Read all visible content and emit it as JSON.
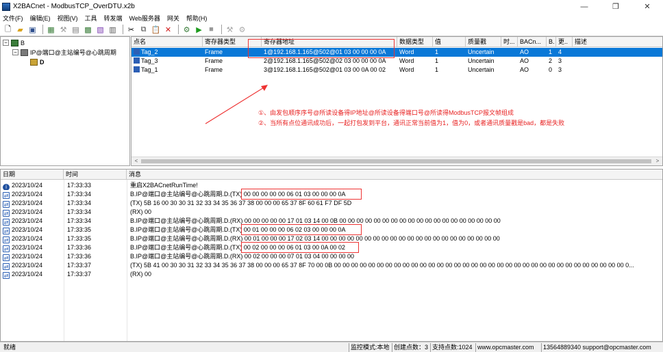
{
  "window": {
    "title": "X2BACnet - ModbusTCP_OverDTU.x2b",
    "controls": [
      "—",
      "❐",
      "✕"
    ]
  },
  "menu": [
    "文件(F)",
    "编辑(E)",
    "视图(V)",
    "工具",
    "转发端",
    "Web服务器",
    "网关",
    "帮助(H)"
  ],
  "toolbar_icons": [
    "new-file-icon",
    "open-folder-icon",
    "save-icon",
    "add-device-icon",
    "add-node-icon",
    "add-group-icon",
    "import-icon",
    "export-icon",
    "properties-icon",
    "cut-icon",
    "copy-icon",
    "paste-icon",
    "delete-icon",
    "monitor-icon",
    "run-icon",
    "stop-icon",
    "tool-a-icon",
    "tool-b-icon"
  ],
  "tree": {
    "root": "B",
    "child": "IP@端口@主站编号@心跳周期",
    "leaf": "D"
  },
  "tag_grid": {
    "columns": [
      "点名",
      "寄存器类型",
      "寄存器地址",
      "数据类型",
      "值",
      "质量戳",
      "时...",
      "BACn...",
      "B.",
      "更..",
      "描述"
    ],
    "rows": [
      {
        "name": "Tag_2",
        "reg_type": "Frame",
        "address": "1@192.168.1.165@502@01 03 00 00 00 0A",
        "data_type": "Word",
        "value": "1",
        "quality": "Uncertain",
        "time": "",
        "bacnet": "AO",
        "b": "1",
        "update": "4",
        "desc": "",
        "selected": true
      },
      {
        "name": "Tag_3",
        "reg_type": "Frame",
        "address": "2@192.168.1.165@502@02 03 00 00 00 0A",
        "data_type": "Word",
        "value": "1",
        "quality": "Uncertain",
        "time": "",
        "bacnet": "AO",
        "b": "2",
        "update": "3",
        "desc": "",
        "selected": false
      },
      {
        "name": "Tag_1",
        "reg_type": "Frame",
        "address": "3@192.168.1.165@502@01 03 00 0A 00 02",
        "data_type": "Word",
        "value": "1",
        "quality": "Uncertain",
        "time": "",
        "bacnet": "AO",
        "b": "0",
        "update": "3",
        "desc": "",
        "selected": false
      }
    ],
    "annotation_line1": "①、由发包顺序序号@所读设备得IP地址@所读设备得端口号@所读得ModbusTCP报文帧组成",
    "annotation_line2": "②、当所有点位通讯成功后，一起打包发到平台，通讯正常当前值为1，值为0，或者通讯质量戳是bad，都是失败"
  },
  "log": {
    "columns": [
      "日期",
      "时间",
      "消息"
    ],
    "rows": [
      {
        "level": "info",
        "date": "2023/10/24",
        "time": "17:33:33",
        "message": "重启X2BACnetRunTime!"
      },
      {
        "level": "comm",
        "date": "2023/10/24",
        "time": "17:33:34",
        "message": "B.IP@端口@主站编号@心跳周期.D.(TX) 00 00 00 00 00 06 01 03 00 00 00 0A"
      },
      {
        "level": "comm",
        "date": "2023/10/24",
        "time": "17:33:34",
        "message": "(TX) 5B 16 00 30 30 31 32 33 34 35 36 37 38 00 00 00 65 37 8F 60 61 F7 DF 5D"
      },
      {
        "level": "comm",
        "date": "2023/10/24",
        "time": "17:33:34",
        "message": "(RX) 00"
      },
      {
        "level": "comm",
        "date": "2023/10/24",
        "time": "17:33:34",
        "message": "B.IP@端口@主站编号@心跳周期.D.(RX) 00 00 00 00 00 17 01 03 14 00 0B 00 00 00 00 00 00 00 00 00 00 00 00 00 00 00 00 00 00 00"
      },
      {
        "level": "comm",
        "date": "2023/10/24",
        "time": "17:33:35",
        "message": "B.IP@端口@主站编号@心跳周期.D.(TX) 00 01 00 00 00 06 02 03 00 00 00 0A"
      },
      {
        "level": "comm",
        "date": "2023/10/24",
        "time": "17:33:35",
        "message": "B.IP@端口@主站编号@心跳周期.D.(RX) 00 01 00 00 00 17 02 03 14 00 00 00 00 00 00 00 00 00 00 00 00 00 00 00 00 00 00 00 00 00"
      },
      {
        "level": "comm",
        "date": "2023/10/24",
        "time": "17:33:36",
        "message": "B.IP@端口@主站编号@心跳周期.D.(TX) 00 02 00 00 00 06 01 03 00 0A 00 02"
      },
      {
        "level": "comm",
        "date": "2023/10/24",
        "time": "17:33:36",
        "message": "B.IP@端口@主站编号@心跳周期.D.(RX) 00 02 00 00 00 07 01 03 04 00 00 00 00"
      },
      {
        "level": "comm",
        "date": "2023/10/24",
        "time": "17:33:37",
        "message": "(TX) 5B 41 00 30 30 31 32 33 34 35 36 37 38 00 00 00 65 37 8F 70 00 0B 00 00 00 00 00 00 00 00 00 00 00 00 00 00 00 00 00 00 00 00 00 00 00 00 00 00 00 00 00 00 00 00 00 00 0..."
      },
      {
        "level": "comm",
        "date": "2023/10/24",
        "time": "17:33:37",
        "message": "(RX) 00"
      }
    ]
  },
  "status": {
    "left": "就绪",
    "mode": "监控模式:本地",
    "created_points": "创建点数：3",
    "supported_points": "支持点数:1024",
    "website": "www.opcmaster.com",
    "contact": "13564889340 support@opcmaster.com"
  }
}
